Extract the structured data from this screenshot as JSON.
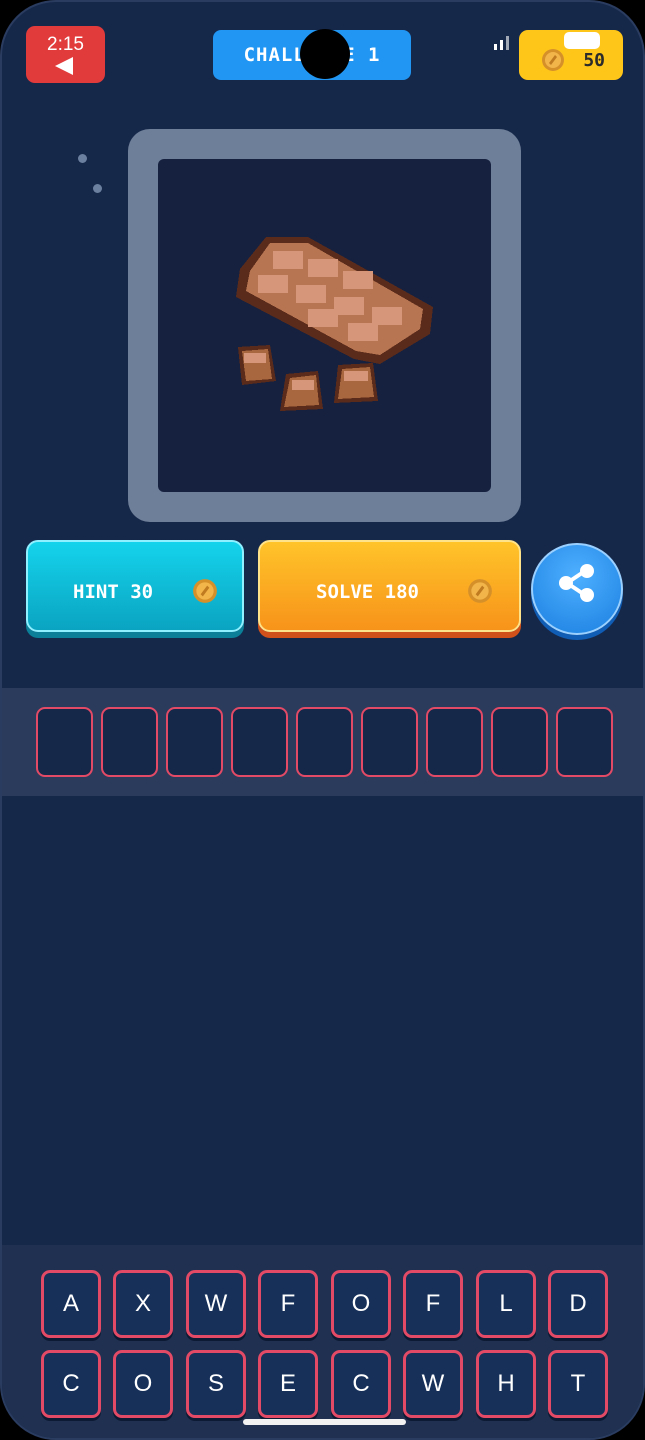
{
  "status": {
    "time": "2:15"
  },
  "header": {
    "title": "CHALLENGE 1",
    "coins": "50"
  },
  "puzzle": {
    "image": "chocolate-bar-pixel-art"
  },
  "actions": {
    "hint_label": "HINT 30",
    "solve_label": "SOLVE 180",
    "share": "share-icon"
  },
  "answer": {
    "slot_count": 9
  },
  "keyboard": {
    "row1": [
      "A",
      "X",
      "W",
      "F",
      "O",
      "F",
      "L",
      "D"
    ],
    "row2": [
      "C",
      "O",
      "S",
      "E",
      "C",
      "W",
      "H",
      "T"
    ]
  },
  "colors": {
    "background": "#16284a",
    "back_button": "#e23b3b",
    "title_pill": "#2196f3",
    "coins_badge": "#ffc61a",
    "hint_button": "#15d3ec",
    "solve_button": "#f7931a",
    "share_button": "#2c8ff0",
    "slot_border": "#e24a66"
  }
}
